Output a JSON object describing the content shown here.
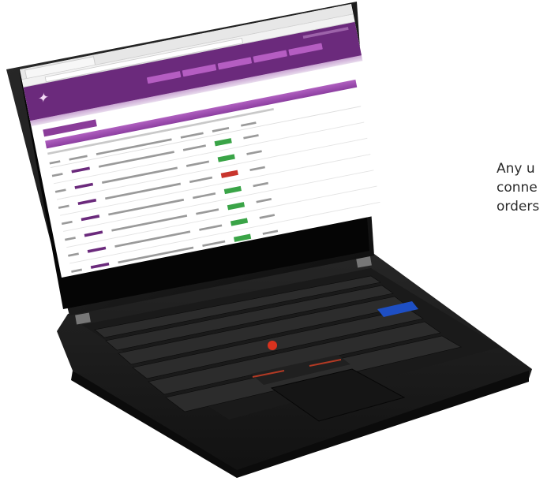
{
  "caption": {
    "lines": [
      "Any u",
      "conne",
      "orders"
    ]
  },
  "laptop": {
    "lid_color": "#141414",
    "body_color": "#1c1c1c",
    "trackpoint_color": "#d8321e",
    "accent_key_color": "#1e4fc4"
  },
  "screen": {
    "brand_color": "#6b2a7c",
    "status_colors": {
      "ok": "#3aa447",
      "error": "#c8352d"
    },
    "rows": [
      {
        "status": "ok"
      },
      {
        "status": "ok"
      },
      {
        "status": "error"
      },
      {
        "status": "ok"
      },
      {
        "status": "ok"
      },
      {
        "status": "ok"
      },
      {
        "status": "ok"
      }
    ]
  }
}
